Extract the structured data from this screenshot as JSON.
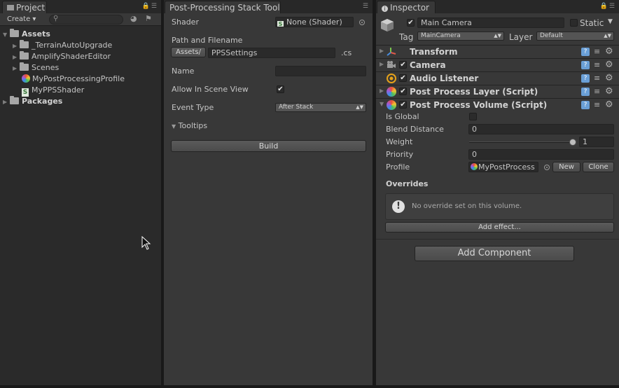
{
  "project": {
    "tab_label": "Project",
    "create_label": "Create ▾",
    "search_placeholder": "",
    "tree": [
      {
        "label": "Assets",
        "type": "folder-open",
        "bold": true
      },
      {
        "label": "_TerrainAutoUpgrade",
        "type": "folder"
      },
      {
        "label": "AmplifyShaderEditor",
        "type": "folder"
      },
      {
        "label": "Scenes",
        "type": "folder"
      },
      {
        "label": "MyPostProcessingProfile",
        "type": "profile"
      },
      {
        "label": "MyPPSShader",
        "type": "shader"
      },
      {
        "label": "Packages",
        "type": "folder",
        "bold": true
      }
    ]
  },
  "pps": {
    "tab_label": "Post-Processing Stack Tool",
    "shader_label": "Shader",
    "shader_value": "None (Shader)",
    "path_label": "Path and Filename",
    "assets_label": "Assets/",
    "filename_value": "PPSSettings",
    "ext_label": ".cs",
    "name_label": "Name",
    "name_value": "",
    "allow_label": "Allow In Scene View",
    "allow_checked": "✔",
    "event_label": "Event Type",
    "event_value": "After Stack",
    "tooltips_label": "Tooltips",
    "build_label": "Build"
  },
  "inspector": {
    "tab_label": "Inspector",
    "object_name": "Main Camera",
    "active_check": "✔",
    "static_label": "Static",
    "tag_label": "Tag",
    "tag_value": "MainCamera",
    "layer_label": "Layer",
    "layer_value": "Default",
    "components": [
      {
        "title": "Transform",
        "checked": false
      },
      {
        "title": "Camera",
        "checked": true
      },
      {
        "title": "Audio Listener",
        "checked": true
      },
      {
        "title": "Post Process Layer (Script)",
        "checked": true
      },
      {
        "title": "Post Process Volume (Script)",
        "checked": true
      }
    ],
    "volume": {
      "is_global_label": "Is Global",
      "blend_label": "Blend Distance",
      "blend_value": "0",
      "weight_label": "Weight",
      "weight_value": "1",
      "weight_fraction": 1,
      "priority_label": "Priority",
      "priority_value": "0",
      "profile_label": "Profile",
      "profile_value": "MyPostProcess",
      "new_label": "New",
      "clone_label": "Clone",
      "overrides_label": "Overrides",
      "no_override_text": "No override set on this volume.",
      "add_effect_label": "Add effect..."
    },
    "add_component_label": "Add Component"
  },
  "icons": {
    "lock": "lock-icon",
    "menu": "menu-icon",
    "help": "help-icon",
    "preset": "preset-icon",
    "gear": "gear-icon",
    "warning": "warning-icon"
  },
  "colors": {
    "panel_bg": "#383838",
    "project_bg": "#2a2a2a",
    "field_bg": "#2a2a2a",
    "button_bg": "#585858",
    "help_blue": "#6a9fd6"
  }
}
